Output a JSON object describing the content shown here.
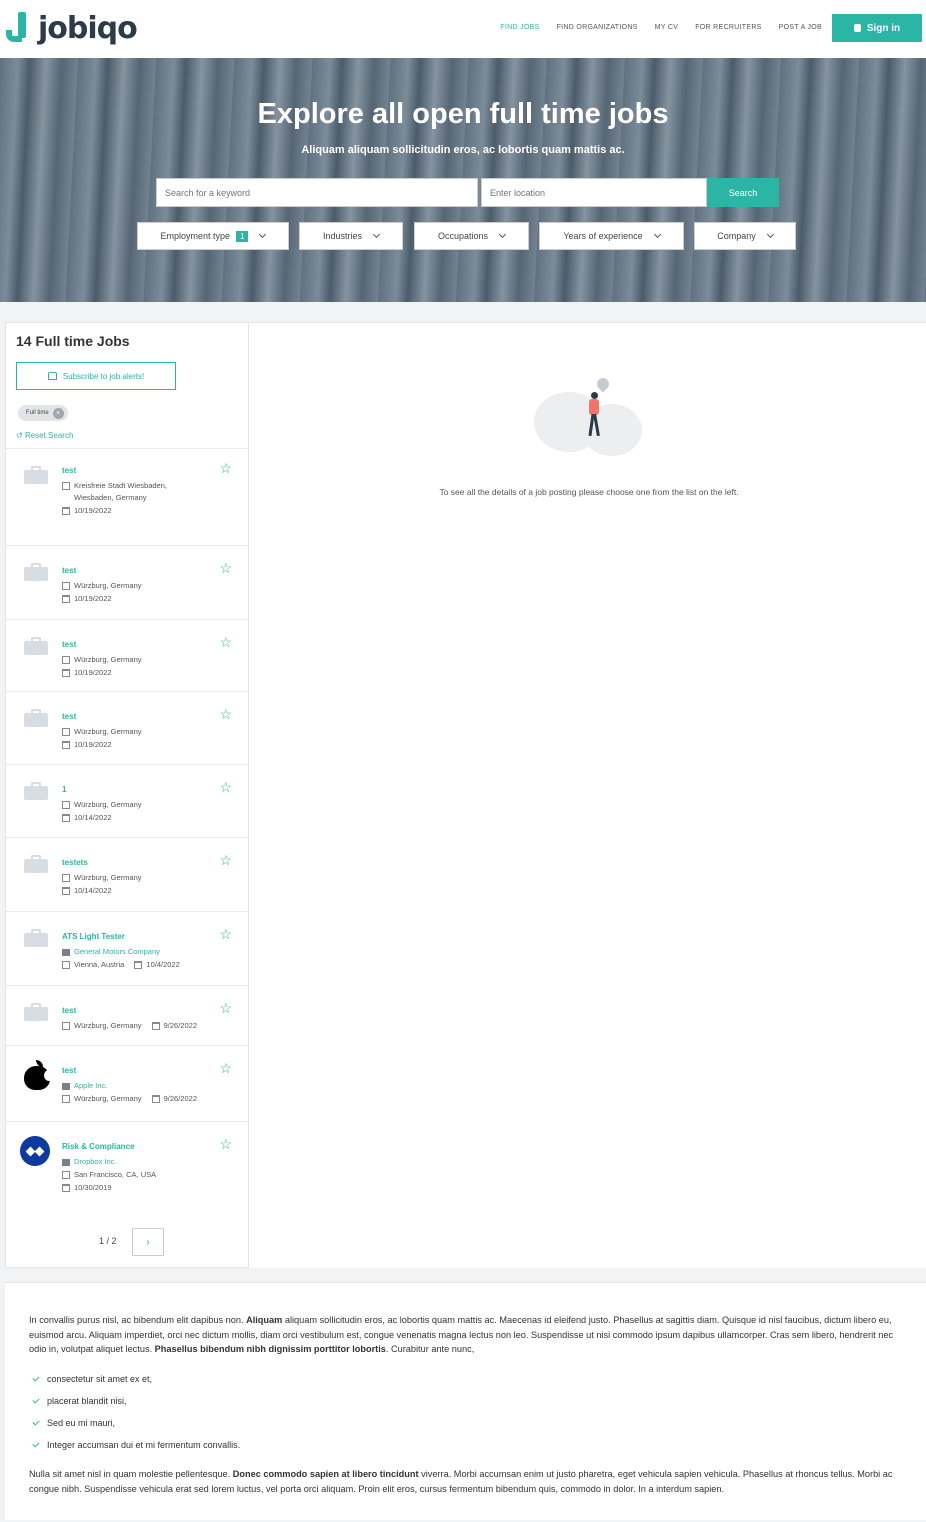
{
  "brand": {
    "name": "jobiqo"
  },
  "nav": {
    "items": [
      {
        "label": "FIND JOBS",
        "active": true
      },
      {
        "label": "FIND ORGANIZATIONS",
        "active": false
      },
      {
        "label": "MY CV",
        "active": false
      },
      {
        "label": "FOR RECRUITERS",
        "active": false
      },
      {
        "label": "POST A JOB",
        "active": false
      }
    ],
    "signin_label": "Sign in"
  },
  "hero": {
    "title": "Explore all open full time jobs",
    "subtitle": "Aliquam aliquam sollicitudin eros, ac lobortis quam mattis ac.",
    "keyword_placeholder": "Search for a keyword",
    "location_placeholder": "Enter location",
    "search_label": "Search",
    "filters": [
      {
        "label": "Employment type",
        "badge": "1"
      },
      {
        "label": "Industries",
        "badge": ""
      },
      {
        "label": "Occupations",
        "badge": ""
      },
      {
        "label": "Years of experience",
        "badge": ""
      },
      {
        "label": "Company",
        "badge": ""
      }
    ]
  },
  "sidebar": {
    "count_title": "14 Full time Jobs",
    "subscribe_label": "Subscribe to job alerts!",
    "active_filter_chip": "Full time",
    "chip_remove": "×",
    "reset_label": "Reset Search",
    "jobs": [
      {
        "title": "test",
        "company": "",
        "location_lines": [
          "Kreisfreie Stadt Wiesbaden,",
          "Wiesbaden, Germany"
        ],
        "date": "10/19/2022",
        "logo": "briefcase",
        "layout": "tall"
      },
      {
        "title": "test",
        "company": "",
        "location_lines": [
          "Würzburg, Germany"
        ],
        "date": "10/19/2022",
        "logo": "briefcase",
        "layout": "normal"
      },
      {
        "title": "test",
        "company": "",
        "location_lines": [
          "Würzburg, Germany"
        ],
        "date": "10/19/2022",
        "logo": "briefcase",
        "layout": "normal"
      },
      {
        "title": "test",
        "company": "",
        "location_lines": [
          "Würzburg, Germany"
        ],
        "date": "10/19/2022",
        "logo": "briefcase",
        "layout": "normal"
      },
      {
        "title": "1",
        "company": "",
        "location_lines": [
          "Würzburg, Germany"
        ],
        "date": "10/14/2022",
        "logo": "briefcase",
        "layout": "normal"
      },
      {
        "title": "testets",
        "company": "",
        "location_lines": [
          "Würzburg, Germany"
        ],
        "date": "10/14/2022",
        "logo": "briefcase",
        "layout": "normal"
      },
      {
        "title": "ATS Light Tester",
        "company": "General Motors Company",
        "location_lines": [
          "Vienna, Austria"
        ],
        "date": "10/4/2022",
        "logo": "briefcase",
        "layout": "inline-date"
      },
      {
        "title": "test",
        "company": "",
        "location_lines": [
          "Würzburg, Germany"
        ],
        "date": "9/26/2022",
        "logo": "briefcase",
        "layout": "inline-date"
      },
      {
        "title": "test",
        "company": "Apple Inc.",
        "location_lines": [
          "Würzburg, Germany"
        ],
        "date": "9/26/2022",
        "logo": "apple",
        "layout": "inline-date"
      },
      {
        "title": "Risk & Compliance",
        "company": "Dropbox Inc.",
        "location_lines": [
          "San Francisco, CA, USA"
        ],
        "date": "10/30/2019",
        "logo": "dropbox",
        "layout": "normal"
      }
    ],
    "pager": {
      "label": "1 / 2",
      "next": "›"
    }
  },
  "detail": {
    "empty_message": "To see all the details of a job posting please choose one from the list on the left."
  },
  "footer": {
    "p1_a": "In convallis purus nisl, ac bibendum elit dapibus non. ",
    "p1_b": "Aliquam",
    "p1_c": " aliquam sollicitudin eros, ac lobortis quam mattis ac. Maecenas id eleifend justo. Phasellus at sagittis diam. Quisque id nisl faucibus, dictum libero eu, euismod arcu. Aliquam imperdiet, orci nec dictum mollis, diam orci vestibulum est, congue venenatis magna lectus non leo. Suspendisse ut nisi commodo ipsum dapibus ullamcorper. Cras sem libero, hendrerit nec odio in, volutpat aliquet lectus. ",
    "p1_d": "Phasellus bibendum nibh dignissim porttitor lobortis",
    "p1_e": ". Curabitur ante nunc,",
    "bullets": [
      "consectetur sit amet ex et,",
      "placerat blandit nisi,",
      "Sed eu mi mauri,",
      "Integer accumsan dui et mi fermentum convallis."
    ],
    "p2_a": "Nulla sit amet nisl in quam molestie pellentesque. ",
    "p2_b": "Donec commodo sapien at libero tincidunt",
    "p2_c": " viverra. Morbi accumsan enim ut justo pharetra, eget vehicula sapien vehicula. Phasellus at rhoncus tellus. Morbi ac congue nibh. Suspendisse vehicula erat sed lorem luctus, vel porta orci aliquam. Proin elit eros, cursus fermentum bibendum quis, commodo in dolor. In a interdum sapien."
  },
  "colors": {
    "accent": "#2bb5a4",
    "dark": "#2d3a4a"
  }
}
